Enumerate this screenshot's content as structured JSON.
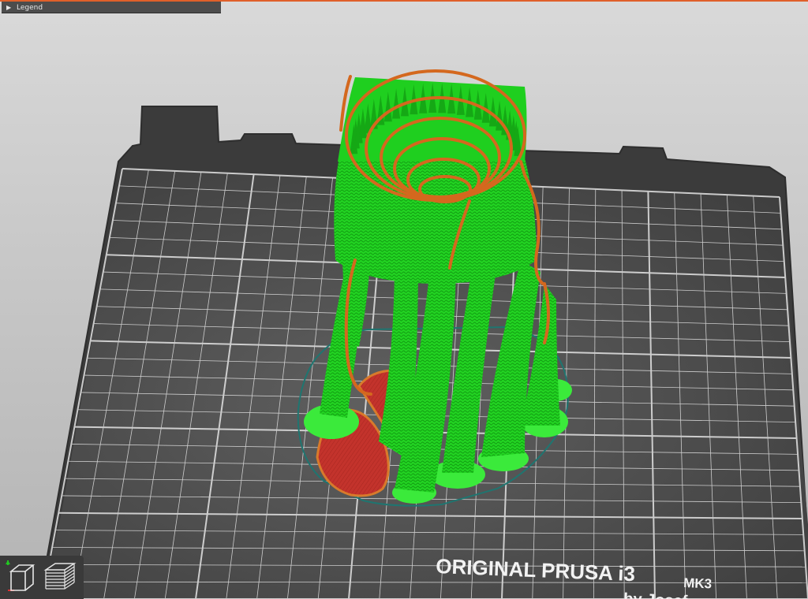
{
  "legend": {
    "label": "Legend",
    "arrow": "▶"
  },
  "bed": {
    "brand_line": "ORIGINAL PRUSA i3",
    "model": "MK3"
  },
  "toolbar": {
    "items": [
      {
        "name": "3d-view",
        "icon": "cube-icon"
      },
      {
        "name": "layers-view",
        "icon": "layers-icon"
      }
    ]
  },
  "colors": {
    "background": "#c9c9c9",
    "bed_frame": "#3a3a3a",
    "bed_surface": "#4a4a4a",
    "grid": "#e9e9e9",
    "support_green": "#1fd41f",
    "perimeter_orange": "#d2691e",
    "solid_infill_red": "#c0302a",
    "skirt_teal": "#1e6f6a"
  }
}
